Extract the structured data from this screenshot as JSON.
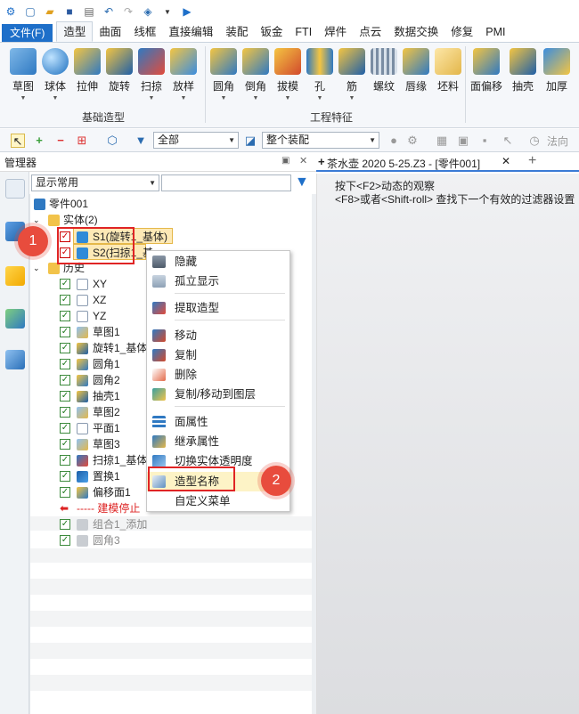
{
  "menu": {
    "file": "文件(F)",
    "tabs": [
      "造型",
      "曲面",
      "线框",
      "直接编辑",
      "装配",
      "钣金",
      "FTI",
      "焊件",
      "点云",
      "数据交换",
      "修复",
      "PMI"
    ]
  },
  "ribbon": {
    "basic": [
      "草图",
      "球体",
      "拉伸",
      "旋转",
      "扫掠",
      "放样"
    ],
    "basic_label": "基础造型",
    "eng": [
      "圆角",
      "倒角",
      "拔模",
      "孔",
      "筋",
      "螺纹",
      "唇缘",
      "坯料"
    ],
    "eng_label": "工程特征",
    "more": [
      "面偏移",
      "抽壳",
      "加厚"
    ]
  },
  "toolbar2": {
    "filter_value": "全部",
    "assembly_value": "整个装配",
    "direction": "法向"
  },
  "manager": {
    "title": "管理器",
    "filter_select": "显示常用",
    "search_value": ""
  },
  "tree": {
    "root": "零件001",
    "solids_label": "实体(2)",
    "s1": "S1(旋转1_基体)",
    "s2": "S2(扫掠1_基",
    "history_label": "历史",
    "items": [
      "XY",
      "XZ",
      "YZ",
      "草图1",
      "旋转1_基体",
      "圆角1",
      "圆角2",
      "抽壳1",
      "草图2",
      "平面1",
      "草图3",
      "扫掠1_基体",
      "置换1",
      "偏移面1"
    ],
    "stop": "----- 建模停止",
    "after": [
      "组合1_添加",
      "圆角3"
    ]
  },
  "document": {
    "tab": "茶水壶 2020 5-25.Z3 - [零件001]",
    "hint1": "按下<F2>动态的观察",
    "hint2": "<F8>或者<Shift-roll> 查找下一个有效的过滤器设置"
  },
  "context_menu": {
    "hide": "隐藏",
    "isolate": "孤立显示",
    "extract": "提取造型",
    "move": "移动",
    "copy": "复制",
    "delete": "删除",
    "copy_move_layer": "复制/移动到图层",
    "face_attr": "面属性",
    "inherit_attr": "继承属性",
    "toggle_transparency": "切换实体透明度",
    "shape_name": "造型名称",
    "custom_menu": "自定义菜单"
  },
  "annotations": {
    "step1": "1",
    "step2": "2"
  }
}
